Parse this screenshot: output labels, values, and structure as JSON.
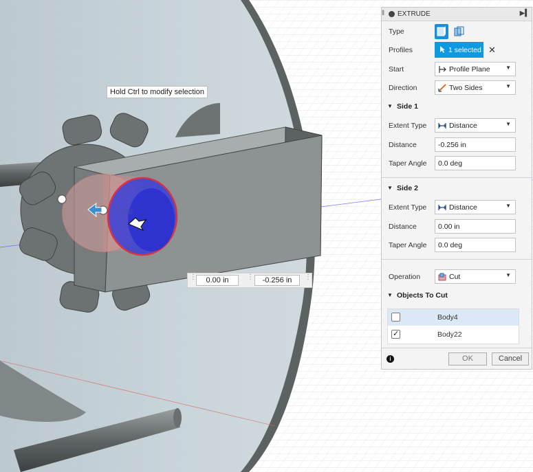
{
  "tooltip": "Hold Ctrl to modify selection",
  "canvas_dimension": "-.256",
  "dimension_inputs": {
    "side2_value": "0.00 in",
    "side1_value": "-0.256 in"
  },
  "panel": {
    "title": "EXTRUDE",
    "rows": {
      "type": {
        "label": "Type"
      },
      "profiles": {
        "label": "Profiles",
        "value": "1 selected",
        "clear": "✕"
      },
      "start": {
        "label": "Start",
        "value": "Profile Plane"
      },
      "direction": {
        "label": "Direction",
        "value": "Two Sides"
      }
    },
    "side1": {
      "title": "Side 1",
      "extent_type": {
        "label": "Extent Type",
        "value": "Distance"
      },
      "distance": {
        "label": "Distance",
        "value": "-0.256 in"
      },
      "taper": {
        "label": "Taper Angle",
        "value": "0.0 deg"
      }
    },
    "side2": {
      "title": "Side 2",
      "extent_type": {
        "label": "Extent Type",
        "value": "Distance"
      },
      "distance": {
        "label": "Distance",
        "value": "0.00 in"
      },
      "taper": {
        "label": "Taper Angle",
        "value": "0.0 deg"
      }
    },
    "operation": {
      "label": "Operation",
      "value": "Cut"
    },
    "objects_to_cut": {
      "title": "Objects To Cut",
      "items": [
        {
          "name": "Body4",
          "checked": false
        },
        {
          "name": "Body22",
          "checked": true
        }
      ]
    },
    "footer": {
      "ok": "OK",
      "cancel": "Cancel"
    }
  },
  "colors": {
    "accent_blue": "#0d9ae0",
    "selection_red": "#e0243a",
    "hole_blue": "#2a2fd0",
    "part_gray": "#8e9494"
  }
}
